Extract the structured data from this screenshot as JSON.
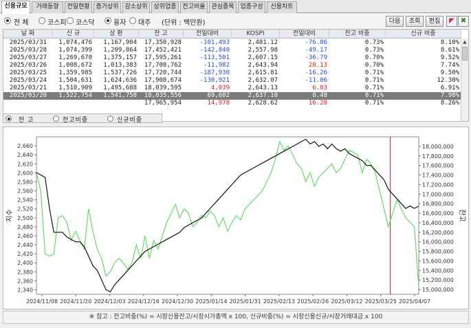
{
  "tabs": [
    {
      "label": "신용규모",
      "active": true
    },
    {
      "label": "거래동향"
    },
    {
      "label": "전일현황"
    },
    {
      "label": "증가상위"
    },
    {
      "label": "감소상위"
    },
    {
      "label": "상위업종"
    },
    {
      "label": "잔고비율"
    },
    {
      "label": "관심종목"
    },
    {
      "label": "업종구성"
    },
    {
      "label": "신용차트"
    }
  ],
  "options": {
    "market": [
      "전 체",
      "코스피",
      "코스닥"
    ],
    "market_selected": 0,
    "type": [
      "융자",
      "대주"
    ],
    "type_selected": 0,
    "unit": "(단위 : 백만원)"
  },
  "buttons": {
    "next": "다음",
    "query": "조회",
    "edit": "편집"
  },
  "icon_buttons": [
    "chart-toggle-icon",
    "excel-export-icon"
  ],
  "table": {
    "headers": [
      "날 짜",
      "신 규",
      "상 환",
      "잔 고",
      "전일대비",
      "KOSPI",
      "전일대비",
      "잔고 비중",
      "신규 비중"
    ],
    "rows": [
      [
        "2025/03/31",
        "1,074,476",
        "1,167,904",
        "17,350,928",
        "-101,493",
        "2,481.12",
        "-76.86",
        "0.73%",
        "8.10%"
      ],
      [
        "2025/03/28",
        "1,074,399",
        "1,209,864",
        "17,452,421",
        "-142,840",
        "2,557.98",
        "-49.17",
        "0.73%",
        "8.61%"
      ],
      [
        "2025/03/27",
        "1,269,670",
        "1,375,157",
        "17,595,261",
        "-113,501",
        "2,607.15",
        "-36.79",
        "0.70%",
        "9.52%"
      ],
      [
        "2025/03/26",
        "1,008,672",
        "1,013,383",
        "17,708,762",
        "-11,982",
        "2,643.94",
        "28.13",
        "0.70%",
        "7.74%"
      ],
      [
        "2025/03/25",
        "1,359,985",
        "1,537,726",
        "17,720,744",
        "-187,930",
        "2,615.81",
        "-16.26",
        "0.71%",
        "9.50%"
      ],
      [
        "2025/03/24",
        "1,504,631",
        "1,624,636",
        "17,908,674",
        "-130,921",
        "2,632.07",
        "-11.06",
        "0.71%",
        "12.30%"
      ],
      [
        "2025/03/21",
        "1,510,909",
        "1,495,688",
        "18,039,595",
        "4,039",
        "2,643.13",
        "6.03",
        "0.71%",
        "6.91%"
      ],
      [
        "2025/03/20",
        "1,522,754",
        "1,541,758",
        "18,035,556",
        "69,602",
        "2,637.10",
        "8.48",
        "0.71%",
        "7.98%"
      ],
      [
        "",
        "",
        "",
        "17,965,954",
        "14,978",
        "2,628.62",
        "16.28",
        "0.71%",
        "8.26%"
      ]
    ],
    "selected_row": 7
  },
  "chart_options": {
    "labels": [
      "잔  고",
      "잔고비중",
      "신규비중"
    ],
    "selected": 0
  },
  "chart_data": {
    "type": "line",
    "x_ticks": [
      "2024/11/08",
      "2024/11/20",
      "2024/12/03",
      "2024/12/16",
      "2024/12/30",
      "2025/01/14",
      "2025/01/31",
      "2025/02/13",
      "2025/02/26",
      "2025/03/12",
      "2025/03/25",
      "2025/04/07"
    ],
    "left_axis": {
      "label": "지수",
      "min": 2330,
      "max": 2680,
      "ticks": [
        "2,340",
        "2,360",
        "2,380",
        "2,400",
        "2,420",
        "2,440",
        "2,460",
        "2,480",
        "2,500",
        "2,520",
        "2,540",
        "2,560",
        "2,580",
        "2,600",
        "2,620",
        "2,640",
        "2,660"
      ]
    },
    "right_axis": {
      "label": "잔고",
      "min": 14900000,
      "max": 18200000,
      "ticks": [
        "15,000,000",
        "15,200,000",
        "15,400,000",
        "15,600,000",
        "15,800,000",
        "16,000,000",
        "16,200,000",
        "16,400,000",
        "16,600,000",
        "16,800,000",
        "17,000,000",
        "17,200,000",
        "17,400,000",
        "17,600,000",
        "17,800,000",
        "18,000,000"
      ]
    },
    "series": [
      {
        "axis": "left",
        "color": "#66dd66",
        "values": [
          2600,
          2560,
          2420,
          2415,
          2420,
          2500,
          2505,
          2490,
          2450,
          2470,
          2450,
          2430,
          2520,
          2470,
          2430,
          2410,
          2370,
          2380,
          2400,
          2410,
          2400,
          2385,
          2400,
          2440,
          2410,
          2460,
          2410,
          2450,
          2430,
          2460,
          2490,
          2510,
          2530,
          2500,
          2520,
          2510,
          2480,
          2490,
          2505,
          2500,
          2515,
          2505,
          2480,
          2500,
          2470,
          2490,
          2505,
          2495,
          2520,
          2530,
          2540,
          2550,
          2560,
          2580,
          2600,
          2630,
          2670,
          2650,
          2660,
          2640,
          2620,
          2610,
          2580,
          2600,
          2570,
          2590,
          2600,
          2610,
          2620,
          2600,
          2610,
          2630,
          2650,
          2645,
          2640,
          2600,
          2630,
          2620,
          2600,
          2560,
          2520,
          2480,
          2510,
          2540,
          2520,
          2500,
          2490,
          2480,
          2345
        ]
      },
      {
        "axis": "right",
        "color": "#111111",
        "values": [
          17450000,
          17400000,
          17350000,
          16700000,
          16200000,
          16200000,
          16200000,
          16100000,
          16050000,
          16000000,
          16000000,
          15900000,
          15700000,
          15500000,
          15400000,
          15200000,
          15000000,
          14950000,
          15100000,
          15200000,
          15300000,
          15400000,
          15500000,
          15600000,
          15700000,
          15800000,
          15850000,
          15900000,
          15950000,
          16000000,
          16050000,
          16100000,
          16150000,
          16200000,
          16300000,
          16350000,
          16400000,
          16450000,
          16500000,
          16600000,
          16700000,
          16800000,
          16900000,
          17000000,
          17100000,
          17200000,
          17300000,
          17400000,
          17450000,
          17500000,
          17550000,
          17600000,
          17650000,
          17700000,
          17750000,
          17800000,
          17850000,
          17900000,
          17950000,
          18000000,
          18050000,
          18100000,
          18150000,
          18050000,
          18100000,
          18000000,
          18050000,
          17950000,
          18050000,
          17950000,
          17900000,
          17950000,
          17850000,
          17800000,
          17750000,
          17700000,
          17600000,
          17600000,
          17500000,
          17400000,
          17300000,
          17100000,
          17000000,
          16900000,
          16800000,
          16700000,
          16750000,
          16700000,
          16750000
        ]
      }
    ],
    "marker_line": {
      "x_label": "2025/03/25",
      "color": "#aa2222"
    }
  },
  "footer": "※ 참고 : 잔고비중(%) = 시장신용잔고/시장시가총액 x 100, 신규비중(%) = 시장신용신규/시장거래대금 x 100"
}
